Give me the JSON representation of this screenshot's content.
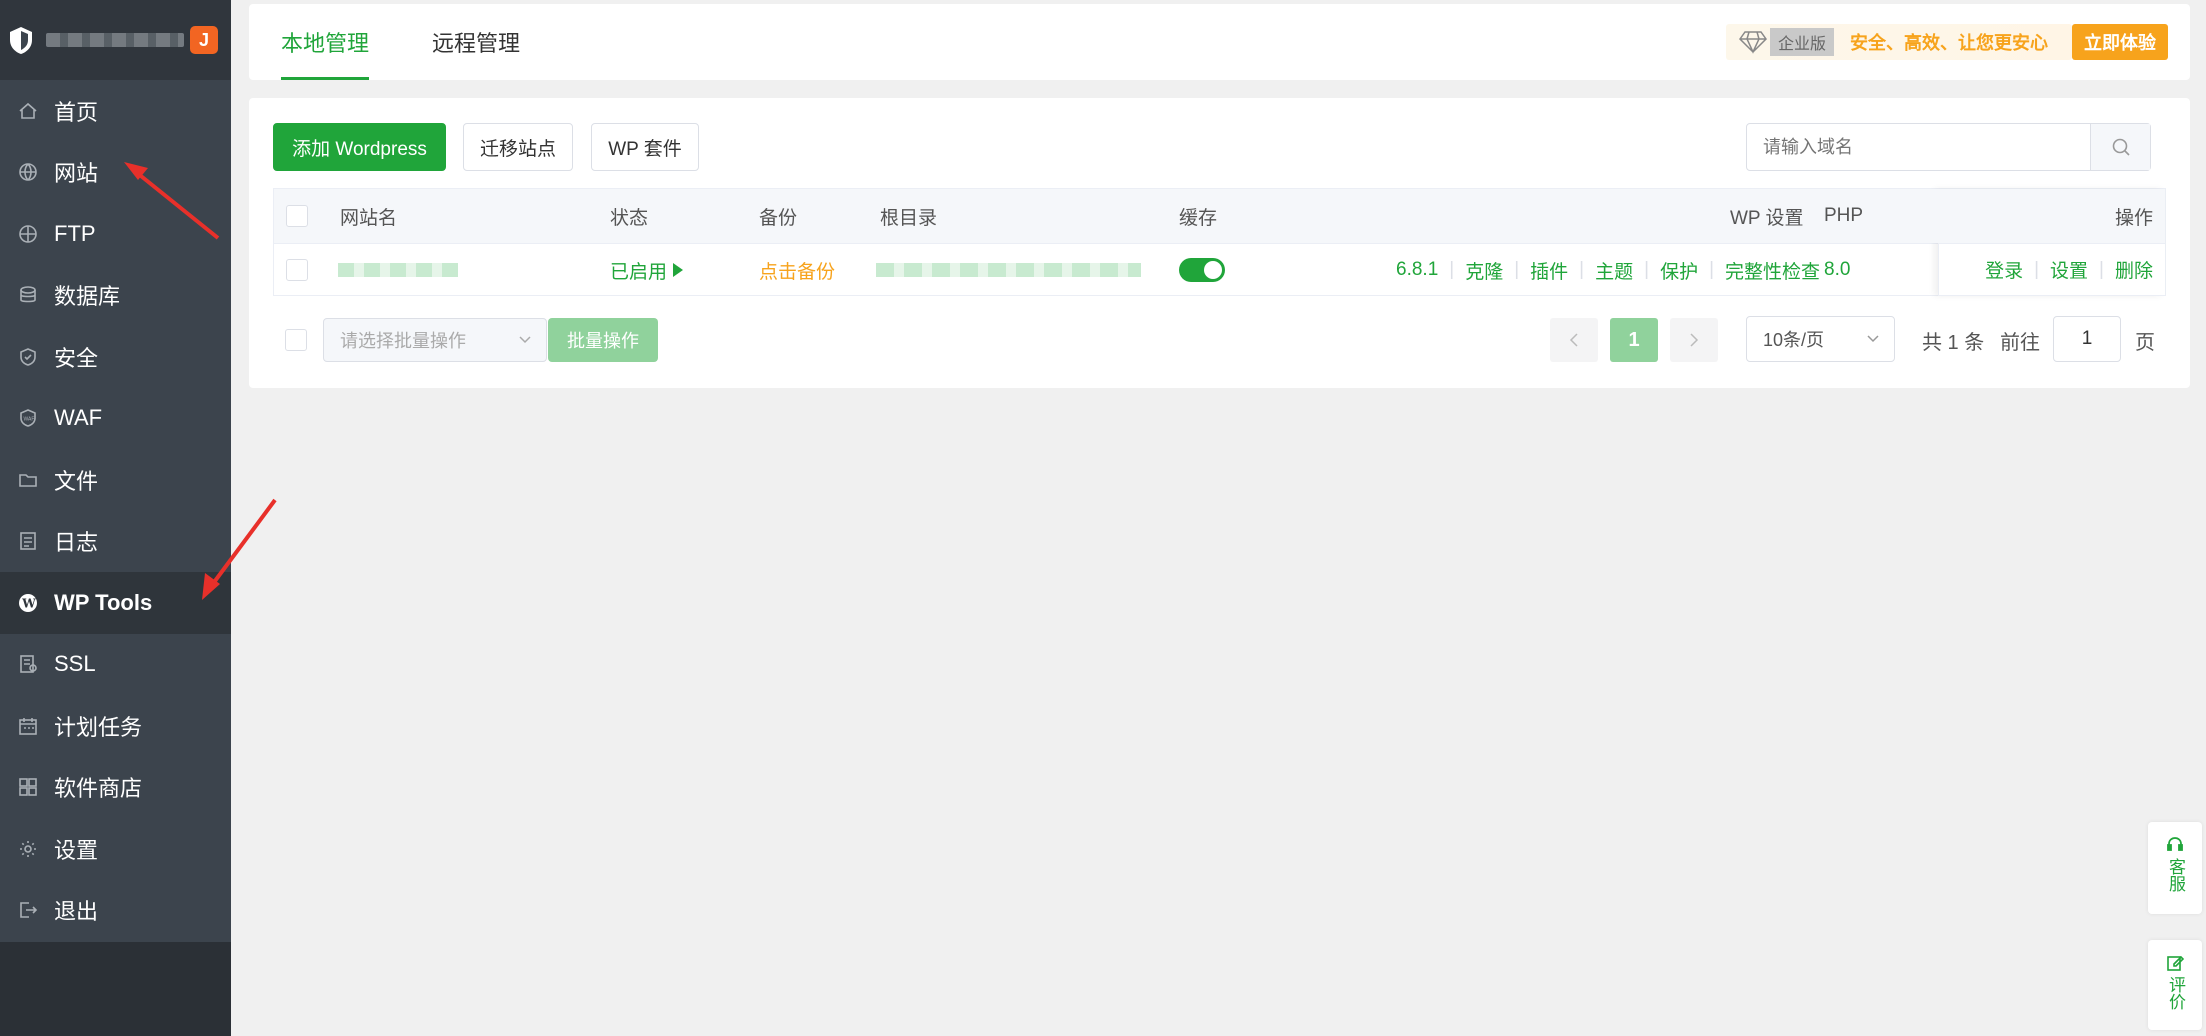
{
  "sidebar": {
    "badge": "J",
    "items": [
      {
        "label": "首页",
        "icon": "home-icon"
      },
      {
        "label": "网站",
        "icon": "globe-icon"
      },
      {
        "label": "FTP",
        "icon": "ftp-icon"
      },
      {
        "label": "数据库",
        "icon": "database-icon"
      },
      {
        "label": "安全",
        "icon": "shield-check-icon"
      },
      {
        "label": "WAF",
        "icon": "waf-icon"
      },
      {
        "label": "文件",
        "icon": "folder-icon"
      },
      {
        "label": "日志",
        "icon": "log-icon"
      },
      {
        "label": "WP Tools",
        "icon": "wordpress-icon",
        "active": true
      },
      {
        "label": "SSL",
        "icon": "ssl-icon"
      },
      {
        "label": "计划任务",
        "icon": "calendar-icon"
      },
      {
        "label": "软件商店",
        "icon": "grid-icon"
      },
      {
        "label": "设置",
        "icon": "gear-icon"
      },
      {
        "label": "退出",
        "icon": "logout-icon"
      }
    ]
  },
  "tabs": {
    "local": "本地管理",
    "remote": "远程管理"
  },
  "promo": {
    "edition": "企业版",
    "slogan": "安全、高效、让您更安心",
    "button": "立即体验"
  },
  "toolbar": {
    "add": "添加 Wordpress",
    "migrate": "迁移站点",
    "kit": "WP 套件"
  },
  "search": {
    "placeholder": "请输入域名"
  },
  "table": {
    "headers": {
      "name": "网站名",
      "status": "状态",
      "backup": "备份",
      "root": "根目录",
      "cache": "缓存",
      "wp": "WP 设置",
      "php": "PHP",
      "ops": "操作"
    },
    "row": {
      "status": "已启用",
      "backup": "点击备份",
      "cache_on": true,
      "wp_version": "6.8.1",
      "wp_links": [
        "克隆",
        "插件",
        "主题",
        "保护",
        "完整性检查"
      ],
      "php": "8.0",
      "ops": [
        "登录",
        "设置",
        "删除"
      ]
    }
  },
  "footer": {
    "batch_placeholder": "请选择批量操作",
    "batch_button": "批量操作",
    "current_page": "1",
    "page_size": "10条/页",
    "total": "共 1 条",
    "goto_label": "前往",
    "goto_value": "1",
    "page_unit": "页"
  },
  "float": {
    "service": "客服",
    "review": "评价"
  },
  "colors": {
    "accent": "#20a53a",
    "sidebar": "#3c444d",
    "promo": "#f7a31c",
    "arrow": "#e8302a"
  }
}
